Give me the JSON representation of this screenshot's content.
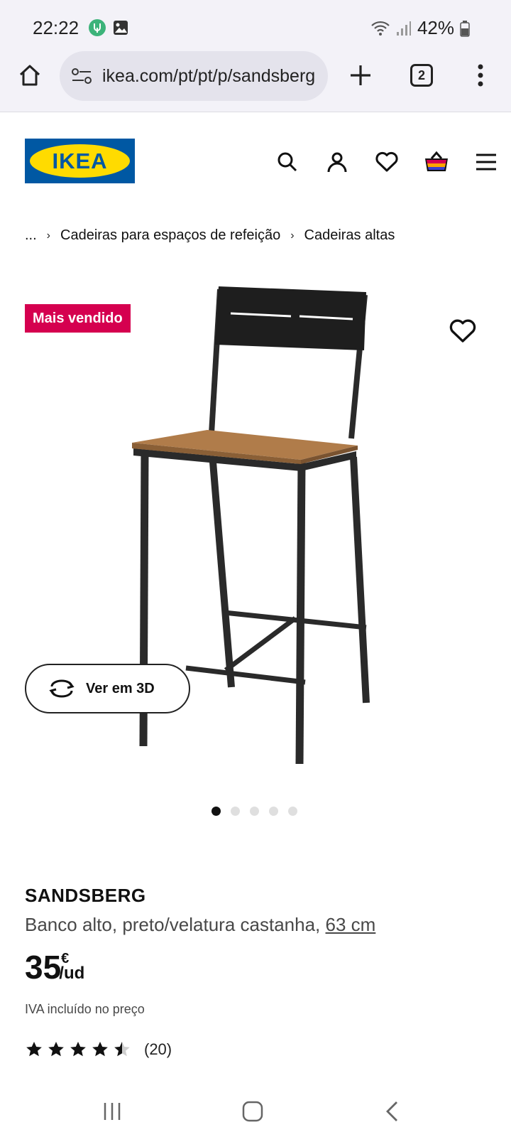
{
  "status_bar": {
    "time": "22:22",
    "battery": "42%",
    "icons": [
      "vpn-icon",
      "gallery-icon",
      "wifi-icon",
      "signal-icon",
      "battery-icon"
    ]
  },
  "browser": {
    "url": "ikea.com/pt/pt/p/sandsberg",
    "tab_count": "2",
    "icons": [
      "home-icon",
      "site-settings-icon",
      "new-tab-icon",
      "tabs-icon",
      "more-icon"
    ]
  },
  "header": {
    "logo_text": "IKEA",
    "logo_colors": {
      "blue": "#0058a3",
      "yellow": "#ffdb00"
    },
    "icons": [
      "search-icon",
      "account-icon",
      "favourites-icon",
      "basket-icon",
      "menu-icon"
    ]
  },
  "breadcrumb": {
    "ellipsis": "...",
    "items": [
      "Cadeiras para espaços de refeição",
      "Cadeiras altas"
    ]
  },
  "gallery": {
    "badge": "Mais vendido",
    "badge_color": "#d5004f",
    "view_3d_label": "Ver em 3D",
    "image_count": 5,
    "active_image": 1
  },
  "product": {
    "name": "SANDSBERG",
    "description": "Banco alto, preto/velatura castanha,",
    "size": "63 cm",
    "price_integer": "35",
    "price_currency": "€",
    "price_unit": "/ud",
    "vat_note": "IVA incluído no preço",
    "rating": 4.5,
    "rating_max": 5,
    "review_count": "(20)"
  },
  "nav_bar": {
    "icons": [
      "recent-apps-icon",
      "home-button-icon",
      "back-icon"
    ]
  }
}
